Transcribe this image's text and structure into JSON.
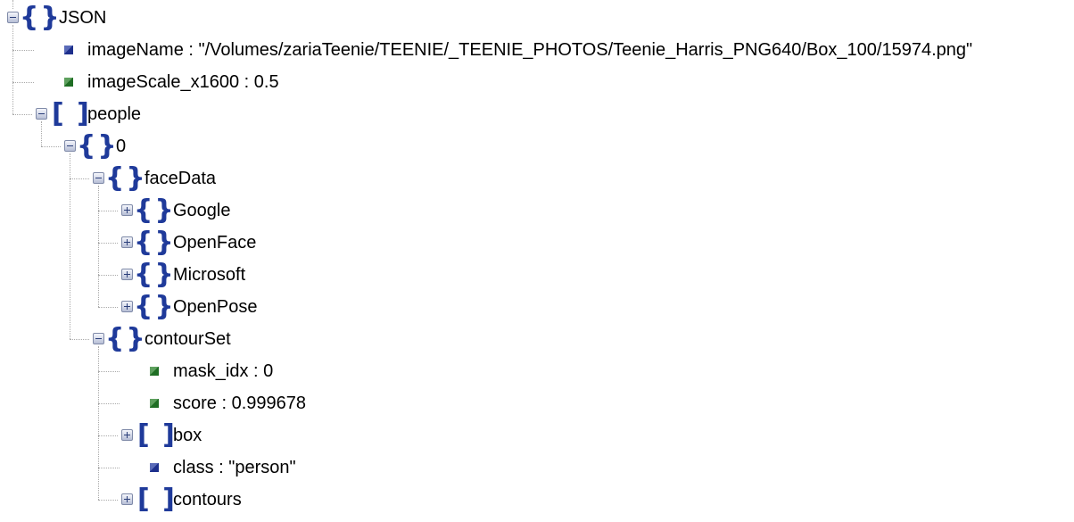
{
  "tree": {
    "label": "JSON",
    "kind": "object",
    "expanded": true,
    "children": [
      {
        "label": "imageName : \"/Volumes/zariaTeenie/TEENIE/_TEENIE_PHOTOS/Teenie_Harris_PNG640/Box_100/15974.png\"",
        "kind": "string"
      },
      {
        "label": "imageScale_x1600 : 0.5",
        "kind": "number"
      },
      {
        "label": "people",
        "kind": "array",
        "expanded": true,
        "children": [
          {
            "label": "0",
            "kind": "object",
            "expanded": true,
            "children": [
              {
                "label": "faceData",
                "kind": "object",
                "expanded": true,
                "children": [
                  {
                    "label": "Google",
                    "kind": "object",
                    "expanded": false
                  },
                  {
                    "label": "OpenFace",
                    "kind": "object",
                    "expanded": false
                  },
                  {
                    "label": "Microsoft",
                    "kind": "object",
                    "expanded": false
                  },
                  {
                    "label": "OpenPose",
                    "kind": "object",
                    "expanded": false
                  }
                ]
              },
              {
                "label": "contourSet",
                "kind": "object",
                "expanded": true,
                "children": [
                  {
                    "label": "mask_idx : 0",
                    "kind": "number"
                  },
                  {
                    "label": "score : 0.999678",
                    "kind": "number"
                  },
                  {
                    "label": "box",
                    "kind": "array",
                    "expanded": false
                  },
                  {
                    "label": "class : \"person\"",
                    "kind": "string"
                  },
                  {
                    "label": "contours",
                    "kind": "array",
                    "expanded": false
                  }
                ]
              }
            ]
          }
        ]
      }
    ]
  },
  "colors": {
    "bracket": "#1f3a9a",
    "string_leaf": "#1d2f8c",
    "number_leaf": "#1f6e24"
  }
}
